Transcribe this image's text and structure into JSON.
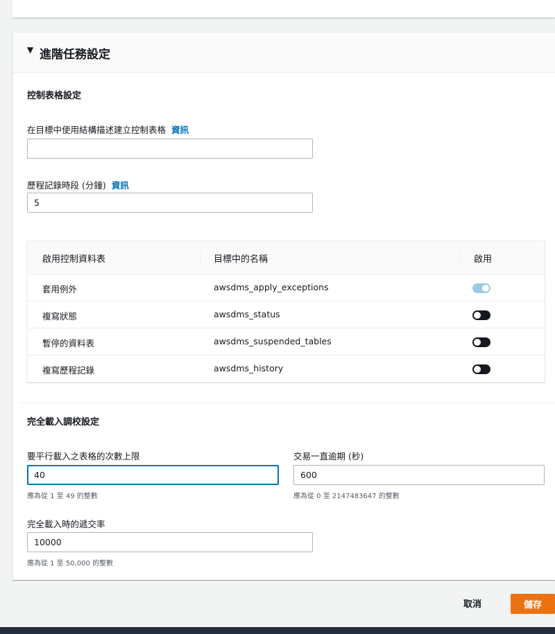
{
  "advanced": {
    "section_title": "進階任務設定",
    "caret": "▼"
  },
  "control_tables": {
    "heading": "控制表格設定",
    "schema_label": "在目標中使用結構描述建立控制表格",
    "schema_info": "資訊",
    "schema_value": "",
    "history_label": "歷程記錄時段 (分鐘)",
    "history_info": "資訊",
    "history_value": "5",
    "table": {
      "columns": [
        "啟用控制資料表",
        "目標中的名稱",
        "啟用"
      ],
      "rows": [
        {
          "table": "套用例外",
          "name": "awsdms_apply_exceptions",
          "enabled": true
        },
        {
          "table": "複寫狀態",
          "name": "awsdms_status",
          "enabled": false
        },
        {
          "table": "暫停的資料表",
          "name": "awsdms_suspended_tables",
          "enabled": false
        },
        {
          "table": "複寫歷程記錄",
          "name": "awsdms_history",
          "enabled": false
        }
      ]
    }
  },
  "full_load": {
    "heading": "完全載入調校設定",
    "max_tables_label": "要平行載入之表格的次數上限",
    "max_tables_value": "40",
    "max_tables_hint": "應為從 1 至 49 的整數",
    "timeout_label": "交易一直逾期 (秒)",
    "timeout_value": "600",
    "timeout_hint": "應為從 0 至 2147483647 的整數",
    "commit_label": "完全載入時的遞交率",
    "commit_value": "10000",
    "commit_hint": "應為從 1 至 50,000 的整數"
  },
  "footer": {
    "cancel_label": "取消",
    "save_label": "儲存"
  },
  "colors": {
    "accent": "#0073bb",
    "primary_button": "#ec7211",
    "toggle_on": "#99cbe4",
    "toggle_off": "#16191f"
  }
}
